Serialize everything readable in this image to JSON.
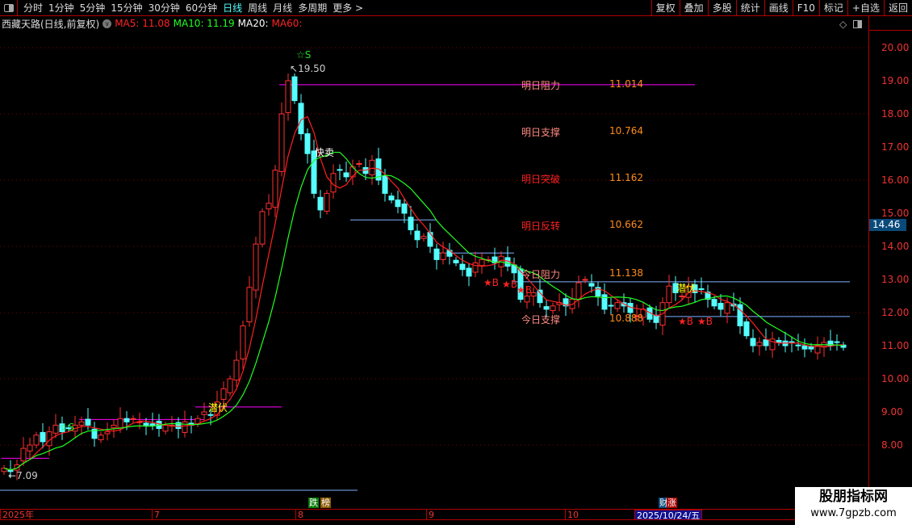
{
  "toolbar": {
    "periods": [
      "分时",
      "1分钟",
      "5分钟",
      "15分钟",
      "30分钟",
      "60分钟",
      "日线",
      "周线",
      "月线",
      "多周期",
      "更多 >"
    ],
    "active": "日线",
    "buttons": [
      "复权",
      "叠加",
      "多股",
      "统计",
      "画线",
      "F10",
      "标记",
      "+自选",
      "返回"
    ]
  },
  "info": {
    "title": "西藏天路(日线,前复权)",
    "ma5": "MA5: 11.08",
    "ma10": "MA10: 11.19",
    "ma20": "MA20:",
    "ma60": "MA60:"
  },
  "axis": {
    "ticks": [
      "20.00",
      "19.00",
      "18.00",
      "17.00",
      "16.00",
      "15.00",
      "14.00",
      "13.00",
      "12.00",
      "11.00",
      "10.00",
      "9.00",
      "8.00"
    ],
    "current_price": "14.46"
  },
  "levels": [
    {
      "label": "明日阻力",
      "value": "11.014",
      "color": "#ff8a80"
    },
    {
      "label": "明日支撑",
      "value": "10.764",
      "color": "#ff8a80"
    },
    {
      "label": "明日突破",
      "value": "11.162",
      "color": "#ff2020"
    },
    {
      "label": "明日反转",
      "value": "10.662",
      "color": "#ff2020"
    },
    {
      "label": "今日阻力",
      "value": "11.138",
      "color": "#ff8a80"
    },
    {
      "label": "今日支撑",
      "value": "10.888",
      "color": "#ff8a80"
    }
  ],
  "annotations": {
    "high": "19.50",
    "low": "7.09",
    "sell": "快卖",
    "ambush": "潜伏",
    "star_s": "☆S",
    "star_b": "★B"
  },
  "dates": {
    "labels": [
      "2025年",
      "7",
      "8",
      "9",
      "10"
    ],
    "current": "2025/10/24/五",
    "tags": [
      "跌",
      "榜",
      "财",
      "涨"
    ]
  },
  "watermark": {
    "name": "股朋指标网",
    "url": "www.7gpzb.com"
  },
  "colors": {
    "up": "#ff3030",
    "down": "#55ffff",
    "ma_fast": "#ff2020",
    "ma_slow": "#20ff20",
    "magenta": "#ff00ff",
    "blue": "#80b0ff"
  },
  "chart_data": {
    "type": "candlestick",
    "ylim": [
      7,
      20.4
    ],
    "closes": [
      7.3,
      7.2,
      7.4,
      7.9,
      8.0,
      8.3,
      8.1,
      8.4,
      8.6,
      8.4,
      8.5,
      8.6,
      8.7,
      8.6,
      8.2,
      8.3,
      8.4,
      8.6,
      8.8,
      8.7,
      8.8,
      8.7,
      8.6,
      8.6,
      8.5,
      8.6,
      8.6,
      8.5,
      8.7,
      8.6,
      8.8,
      9.0,
      8.9,
      9.3,
      9.7,
      10.0,
      10.56,
      11.6,
      12.76,
      14.07,
      15.05,
      15.3,
      16.3,
      18.0,
      19.0,
      18.4,
      17.4,
      16.8,
      15.6,
      15.1,
      15.6,
      16.2,
      16.3,
      16.1,
      16.4,
      16.5,
      16.2,
      16.6,
      16.0,
      15.6,
      15.4,
      15.2,
      15.0,
      14.5,
      14.2,
      14.3,
      14.0,
      13.6,
      13.8,
      13.7,
      13.5,
      13.3,
      13.1,
      13.5,
      13.6,
      13.6,
      13.5,
      13.7,
      13.4,
      13.2,
      12.4,
      12.5,
      12.6,
      12.3,
      12.1,
      12.2,
      12.3,
      12.2,
      12.4,
      12.9,
      13.0,
      12.8,
      12.5,
      12.1,
      12.2,
      12.3,
      12.2,
      12.0,
      11.9,
      12.1,
      11.8,
      11.7,
      12.3,
      12.8,
      12.6,
      12.5,
      12.8,
      12.6,
      12.7,
      12.4,
      12.2,
      12.1,
      12.3,
      12.2,
      11.6,
      11.3,
      11.0,
      11.1,
      11.0,
      11.2,
      11.1,
      11.0,
      11.1,
      11.0,
      10.9,
      10.9,
      11.0,
      11.1,
      11.0,
      11.1,
      10.95
    ],
    "hlines": [
      {
        "price": 18.88,
        "from": 43,
        "to": 107,
        "color": "magenta"
      },
      {
        "price": 14.8,
        "from": 54,
        "to": 67,
        "color": "blue"
      },
      {
        "price": 13.8,
        "from": 67,
        "to": 79,
        "color": "blue"
      },
      {
        "price": 12.93,
        "from": 79,
        "to": 131,
        "color": "blue"
      },
      {
        "price": 11.88,
        "from": 101,
        "to": 131,
        "color": "blue"
      },
      {
        "price": 9.15,
        "from": 30,
        "to": 43,
        "color": "magenta"
      },
      {
        "price": 8.77,
        "from": 12,
        "to": 31,
        "color": "magenta"
      },
      {
        "price": 7.6,
        "from": 0,
        "to": 7,
        "color": "magenta"
      }
    ]
  }
}
